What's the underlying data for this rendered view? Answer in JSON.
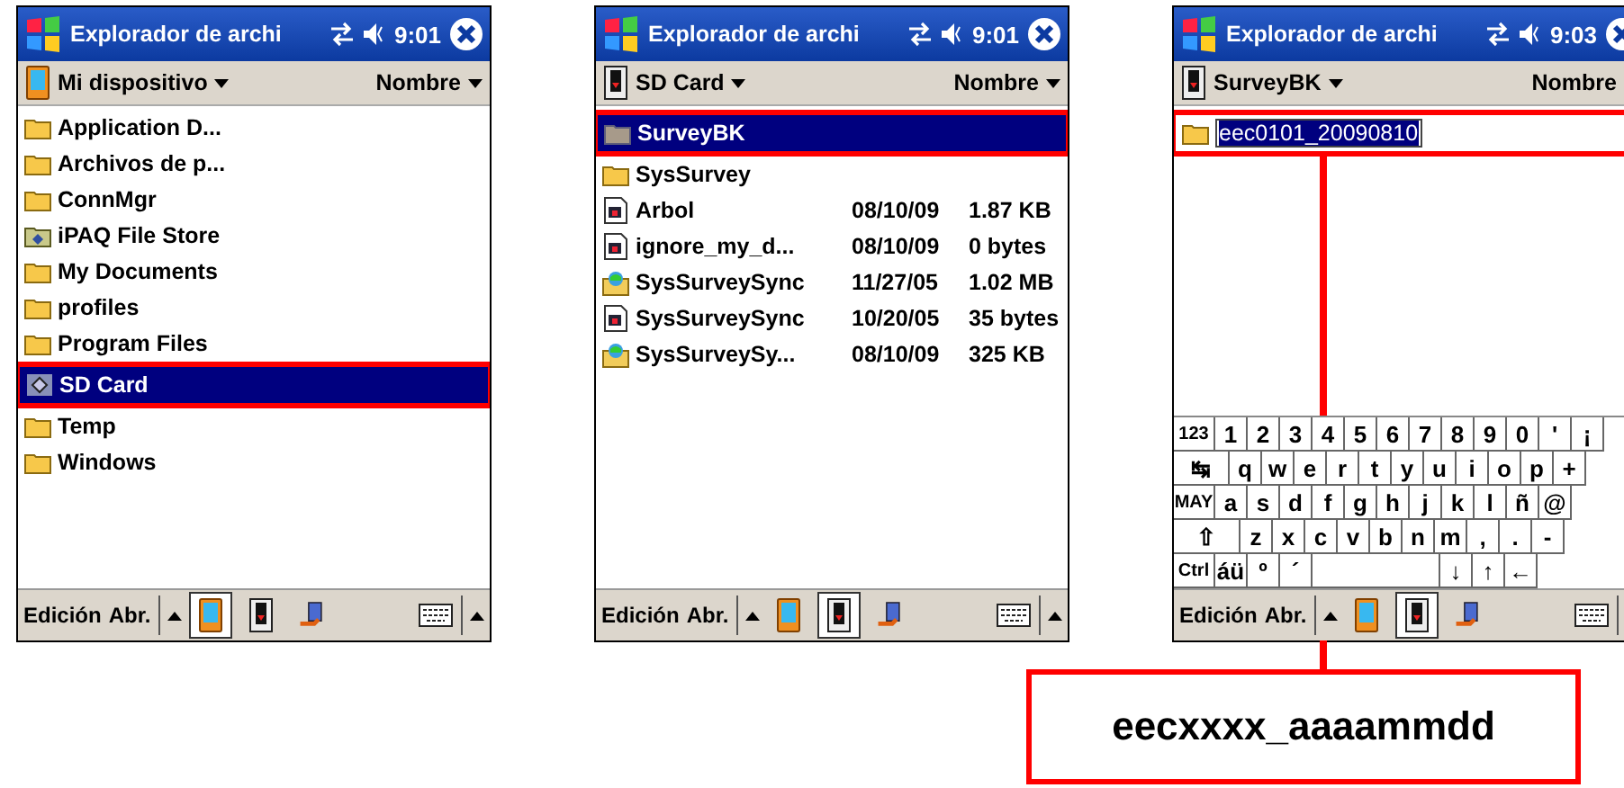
{
  "screens": [
    {
      "title": "Explorador de archi",
      "time": "9:01",
      "header": {
        "location": "Mi dispositivo",
        "kind": "device",
        "sort": "Nombre"
      },
      "items": [
        {
          "kind": "folder",
          "name": "Application D...",
          "selected": false,
          "annotated": false
        },
        {
          "kind": "folder",
          "name": "Archivos de p...",
          "selected": false,
          "annotated": false
        },
        {
          "kind": "folder",
          "name": "ConnMgr",
          "selected": false,
          "annotated": false
        },
        {
          "kind": "store",
          "name": "iPAQ File Store",
          "selected": false,
          "annotated": false
        },
        {
          "kind": "folder",
          "name": "My Documents",
          "selected": false,
          "annotated": false
        },
        {
          "kind": "folder",
          "name": "profiles",
          "selected": false,
          "annotated": false
        },
        {
          "kind": "folder",
          "name": "Program Files",
          "selected": false,
          "annotated": false
        },
        {
          "kind": "card",
          "name": "SD Card",
          "selected": true,
          "annotated": true
        },
        {
          "kind": "folder",
          "name": "Temp",
          "selected": false,
          "annotated": false
        },
        {
          "kind": "folder",
          "name": "Windows",
          "selected": false,
          "annotated": false
        }
      ],
      "menu": [
        "Edición",
        "Abr."
      ],
      "toolbar": [
        {
          "kind": "device",
          "selected": true
        },
        {
          "kind": "card",
          "selected": false
        },
        {
          "kind": "network",
          "selected": false
        }
      ]
    },
    {
      "title": "Explorador de archi",
      "time": "9:01",
      "header": {
        "location": "SD Card",
        "kind": "card",
        "sort": "Nombre"
      },
      "items": [
        {
          "kind": "hidden_folder",
          "name": "SurveyBK",
          "selected": true,
          "annotated": true
        },
        {
          "kind": "folder",
          "name": "SysSurvey",
          "selected": false,
          "annotated": false
        },
        {
          "kind": "doc",
          "name": "Arbol",
          "date": "08/10/09",
          "size": "1.87 KB",
          "selected": false,
          "annotated": false
        },
        {
          "kind": "doc",
          "name": "ignore_my_d...",
          "date": "08/10/09",
          "size": "0 bytes",
          "selected": false,
          "annotated": false
        },
        {
          "kind": "package",
          "name": "SysSurveySync",
          "date": "11/27/05",
          "size": "1.02 MB",
          "selected": false,
          "annotated": false
        },
        {
          "kind": "doc",
          "name": "SysSurveySync",
          "date": "10/20/05",
          "size": "35 bytes",
          "selected": false,
          "annotated": false
        },
        {
          "kind": "package",
          "name": "SysSurveySy...",
          "date": "08/10/09",
          "size": "325 KB",
          "selected": false,
          "annotated": false
        }
      ],
      "menu": [
        "Edición",
        "Abr."
      ],
      "toolbar": [
        {
          "kind": "device",
          "selected": false
        },
        {
          "kind": "card",
          "selected": true
        },
        {
          "kind": "network",
          "selected": false
        }
      ]
    },
    {
      "title": "Explorador de archi",
      "time": "9:03",
      "header": {
        "location": "SurveyBK",
        "kind": "card",
        "sort": "Nombre"
      },
      "items": [
        {
          "kind": "folder",
          "name": "eec0101_20090810",
          "editing": true,
          "selected": true,
          "annotated": true
        }
      ],
      "keyboard": [
        [
          {
            "kind": "wide",
            "label": "123"
          },
          {
            "kind": "key",
            "label": "1"
          },
          {
            "kind": "key",
            "label": "2"
          },
          {
            "kind": "key",
            "label": "3"
          },
          {
            "kind": "key",
            "label": "4"
          },
          {
            "kind": "key",
            "label": "5"
          },
          {
            "kind": "key",
            "label": "6"
          },
          {
            "kind": "key",
            "label": "7"
          },
          {
            "kind": "key",
            "label": "8"
          },
          {
            "kind": "key",
            "label": "9"
          },
          {
            "kind": "key",
            "label": "0"
          },
          {
            "kind": "key",
            "label": "'"
          },
          {
            "kind": "key",
            "label": "¡"
          }
        ],
        [
          {
            "kind": "wider",
            "label": "↹"
          },
          {
            "kind": "key",
            "label": "q"
          },
          {
            "kind": "key",
            "label": "w"
          },
          {
            "kind": "key",
            "label": "e"
          },
          {
            "kind": "key",
            "label": "r"
          },
          {
            "kind": "key",
            "label": "t"
          },
          {
            "kind": "key",
            "label": "y"
          },
          {
            "kind": "key",
            "label": "u"
          },
          {
            "kind": "key",
            "label": "i"
          },
          {
            "kind": "key",
            "label": "o"
          },
          {
            "kind": "key",
            "label": "p"
          },
          {
            "kind": "key",
            "label": "+"
          }
        ],
        [
          {
            "kind": "wide",
            "label": "MAY"
          },
          {
            "kind": "key",
            "label": "a"
          },
          {
            "kind": "key",
            "label": "s"
          },
          {
            "kind": "key",
            "label": "d"
          },
          {
            "kind": "key",
            "label": "f"
          },
          {
            "kind": "key",
            "label": "g"
          },
          {
            "kind": "key",
            "label": "h"
          },
          {
            "kind": "key",
            "label": "j"
          },
          {
            "kind": "key",
            "label": "k"
          },
          {
            "kind": "key",
            "label": "l"
          },
          {
            "kind": "key",
            "label": "ñ"
          },
          {
            "kind": "key",
            "label": "@"
          }
        ],
        [
          {
            "kind": "widest",
            "label": "⇧"
          },
          {
            "kind": "key",
            "label": "z"
          },
          {
            "kind": "key",
            "label": "x"
          },
          {
            "kind": "key",
            "label": "c"
          },
          {
            "kind": "key",
            "label": "v"
          },
          {
            "kind": "key",
            "label": "b"
          },
          {
            "kind": "key",
            "label": "n"
          },
          {
            "kind": "key",
            "label": "m"
          },
          {
            "kind": "key",
            "label": ","
          },
          {
            "kind": "key",
            "label": "."
          },
          {
            "kind": "key",
            "label": "-"
          }
        ],
        [
          {
            "kind": "wide",
            "label": "Ctrl"
          },
          {
            "kind": "key",
            "label": "áü"
          },
          {
            "kind": "key",
            "label": "º"
          },
          {
            "kind": "key",
            "label": "´"
          },
          {
            "kind": "space"
          },
          {
            "kind": "key",
            "label": "↓"
          },
          {
            "kind": "key",
            "label": "↑"
          },
          {
            "kind": "key",
            "label": "←"
          }
        ]
      ],
      "menu": [
        "Edición",
        "Abr."
      ],
      "toolbar": [
        {
          "kind": "device",
          "selected": false
        },
        {
          "kind": "card",
          "selected": true
        },
        {
          "kind": "network",
          "selected": false
        }
      ]
    }
  ],
  "callout": {
    "text": "eecxxxx_aaaammdd"
  }
}
